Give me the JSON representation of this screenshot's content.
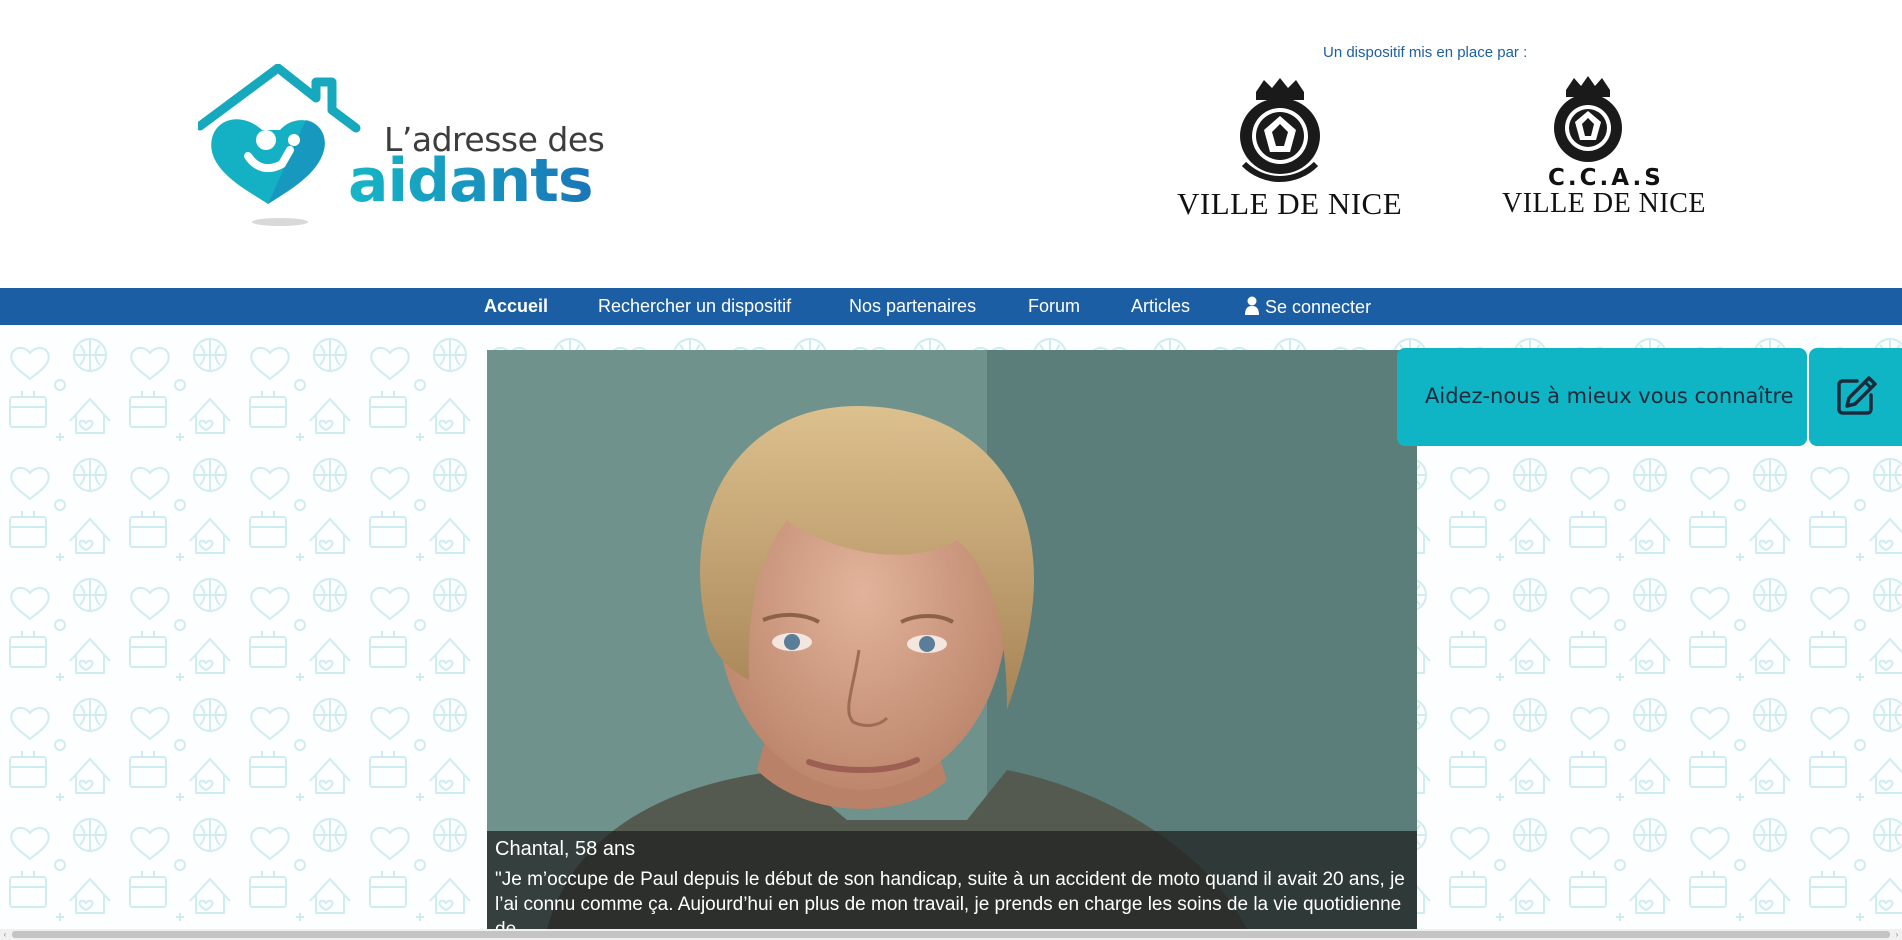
{
  "header": {
    "logo_line1": "L’adresse des",
    "logo_line2": "aidants",
    "partner_caption": "Un dispositif mis en place par :",
    "partner_nice": "VILLE DE NICE",
    "partner_ccas_top": "C.C.A.S",
    "partner_ccas_bottom": "VILLE DE NICE"
  },
  "nav": {
    "items": [
      {
        "label": "Accueil",
        "active": true
      },
      {
        "label": "Rechercher un dispositif"
      },
      {
        "label": "Nos partenaires"
      },
      {
        "label": "Forum"
      },
      {
        "label": "Articles"
      },
      {
        "label": "Se connecter",
        "icon": "user-icon"
      }
    ]
  },
  "hero": {
    "name": "Chantal, 58 ans",
    "quote": "\"Je m’occupe de Paul depuis le début de son handicap, suite à un accident de moto quand il avait 20 ans, je l’ai connu comme ça. Aujourd’hui en plus de mon travail, je prends en charge les soins de la vie quotidienne de"
  },
  "cta": {
    "label": "Aidez-nous à mieux vous connaître",
    "icon": "edit-icon"
  },
  "colors": {
    "nav_bg": "#1b5ea3",
    "accent": "#0fb5c4",
    "caption_blue": "#1d5fa4"
  }
}
